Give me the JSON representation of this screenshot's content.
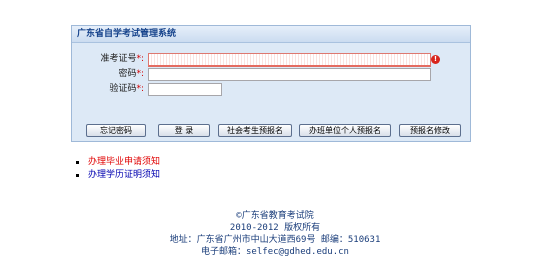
{
  "panel": {
    "title": "广东省自学考试管理系统"
  },
  "form": {
    "ticket": {
      "label": "准考证号",
      "required_mark": "*:",
      "value": ""
    },
    "password": {
      "label": "密码",
      "required_mark": "*:",
      "value": ""
    },
    "captcha": {
      "label": "验证码",
      "required_mark": "*:",
      "value": ""
    },
    "error_icon": "!"
  },
  "buttons": {
    "forgot": "忘记密码",
    "login": "登 录",
    "social_register": "社会考生预报名",
    "unit_register": "办班单位个人预报名",
    "modify_register": "预报名修改"
  },
  "notices": [
    {
      "text": "办理毕业申请须知",
      "color": "#e00000"
    },
    {
      "text": "办理学历证明须知",
      "color": "#0000b0"
    }
  ],
  "footer": {
    "org": "©广东省教育考试院",
    "copyright": "2010-2012 版权所有",
    "address": "地址：广东省广州市中山大道西69号 邮编：510631",
    "email": "电子邮箱：selfec@gdhed.edu.cn"
  }
}
